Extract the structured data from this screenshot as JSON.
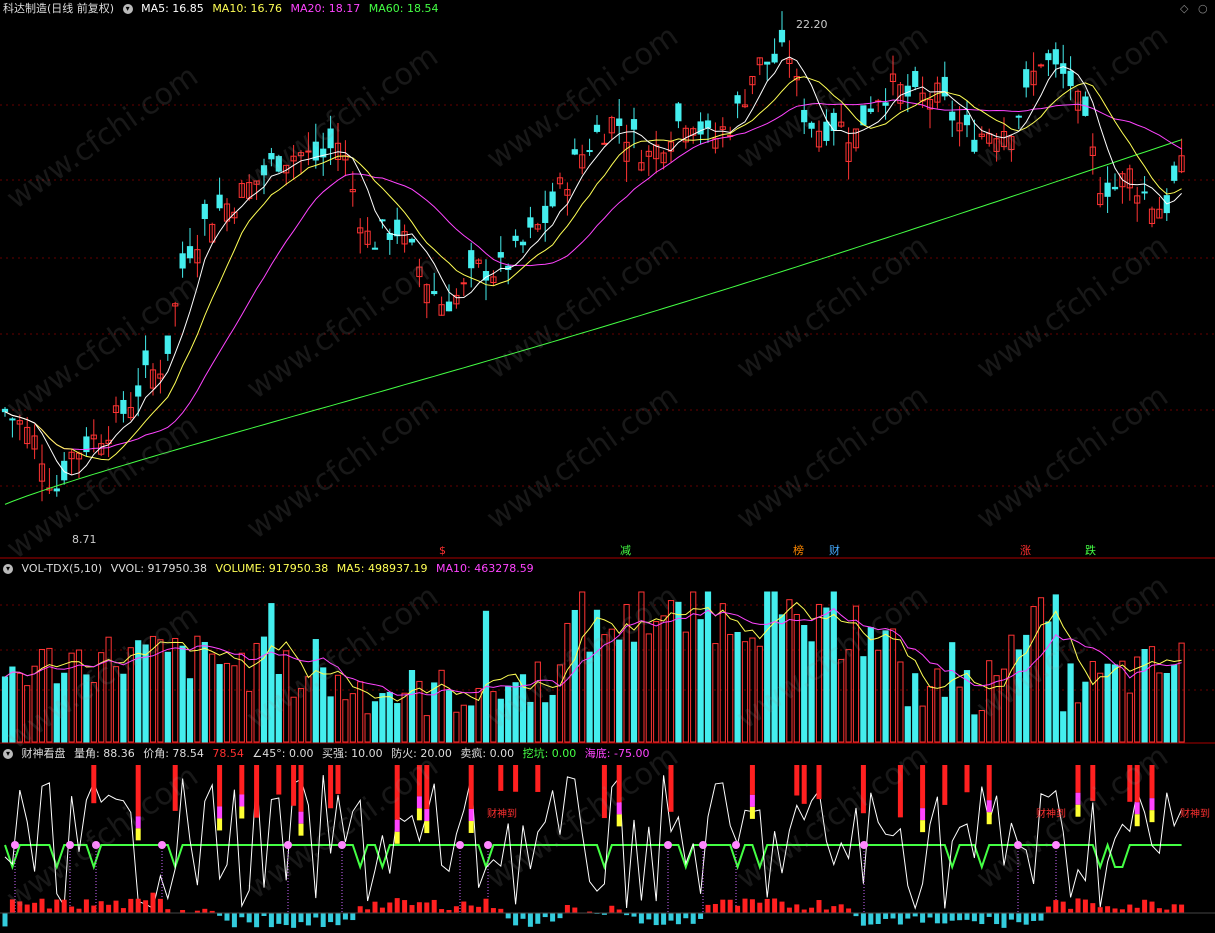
{
  "title": "科达制造",
  "period_label": "(日线 前复权)",
  "main_indicators": [
    {
      "label": "MA5: 16.85",
      "color": "#ffffff"
    },
    {
      "label": "MA10: 16.76",
      "color": "#ffff55"
    },
    {
      "label": "MA20: 18.17",
      "color": "#ff44ff"
    },
    {
      "label": "MA60: 18.54",
      "color": "#44ff44"
    }
  ],
  "price_high_label": "22.20",
  "price_low_label": "8.71",
  "signals": [
    {
      "text": "$",
      "color": "#ff3030"
    },
    {
      "text": "减",
      "color": "#44ff44"
    },
    {
      "text": "榜",
      "color": "#ff8800"
    },
    {
      "text": "财",
      "color": "#44aaff"
    },
    {
      "text": "涨",
      "color": "#ff3030"
    },
    {
      "text": "跌",
      "color": "#44ff44"
    }
  ],
  "vol_indicators": [
    {
      "label": "VOL-TDX(5,10)",
      "color": "#dddddd"
    },
    {
      "label": "VVOL: 917950.38",
      "color": "#dddddd"
    },
    {
      "label": "VOLUME: 917950.38",
      "color": "#ffff55"
    },
    {
      "label": "MA5: 498937.19",
      "color": "#ffff55"
    },
    {
      "label": "MA10: 463278.59",
      "color": "#ff44ff"
    }
  ],
  "ind_indicators": [
    {
      "label": "财神看盘",
      "color": "#dddddd"
    },
    {
      "label": "量角: 88.36",
      "color": "#dddddd"
    },
    {
      "label": "价角: 78.54",
      "color": "#dddddd"
    },
    {
      "label": "78.54",
      "color": "#ff3030"
    },
    {
      "label": "∠45°: 0.00",
      "color": "#dddddd"
    },
    {
      "label": "买强: 10.00",
      "color": "#dddddd"
    },
    {
      "label": "防火: 20.00",
      "color": "#dddddd"
    },
    {
      "label": "卖疯: 0.00",
      "color": "#dddddd"
    },
    {
      "label": "挖坑: 0.00",
      "color": "#44ff44"
    },
    {
      "label": "海底: -75.00",
      "color": "#ff44ff"
    }
  ],
  "ind_tag_text": "财神到",
  "watermark": "www.cfchi.com",
  "colors": {
    "up": "#ff3333",
    "down": "#44eeee",
    "ma5": "#ffffff",
    "ma10": "#ffff55",
    "ma20": "#ff44ff",
    "ma60": "#44ff44",
    "grid": "#660000"
  },
  "chart_data": {
    "type": "candlestick",
    "price_max": 22.2,
    "price_min": 8.71,
    "bars": 160,
    "ylim": [
      8.0,
      23.0
    ]
  }
}
